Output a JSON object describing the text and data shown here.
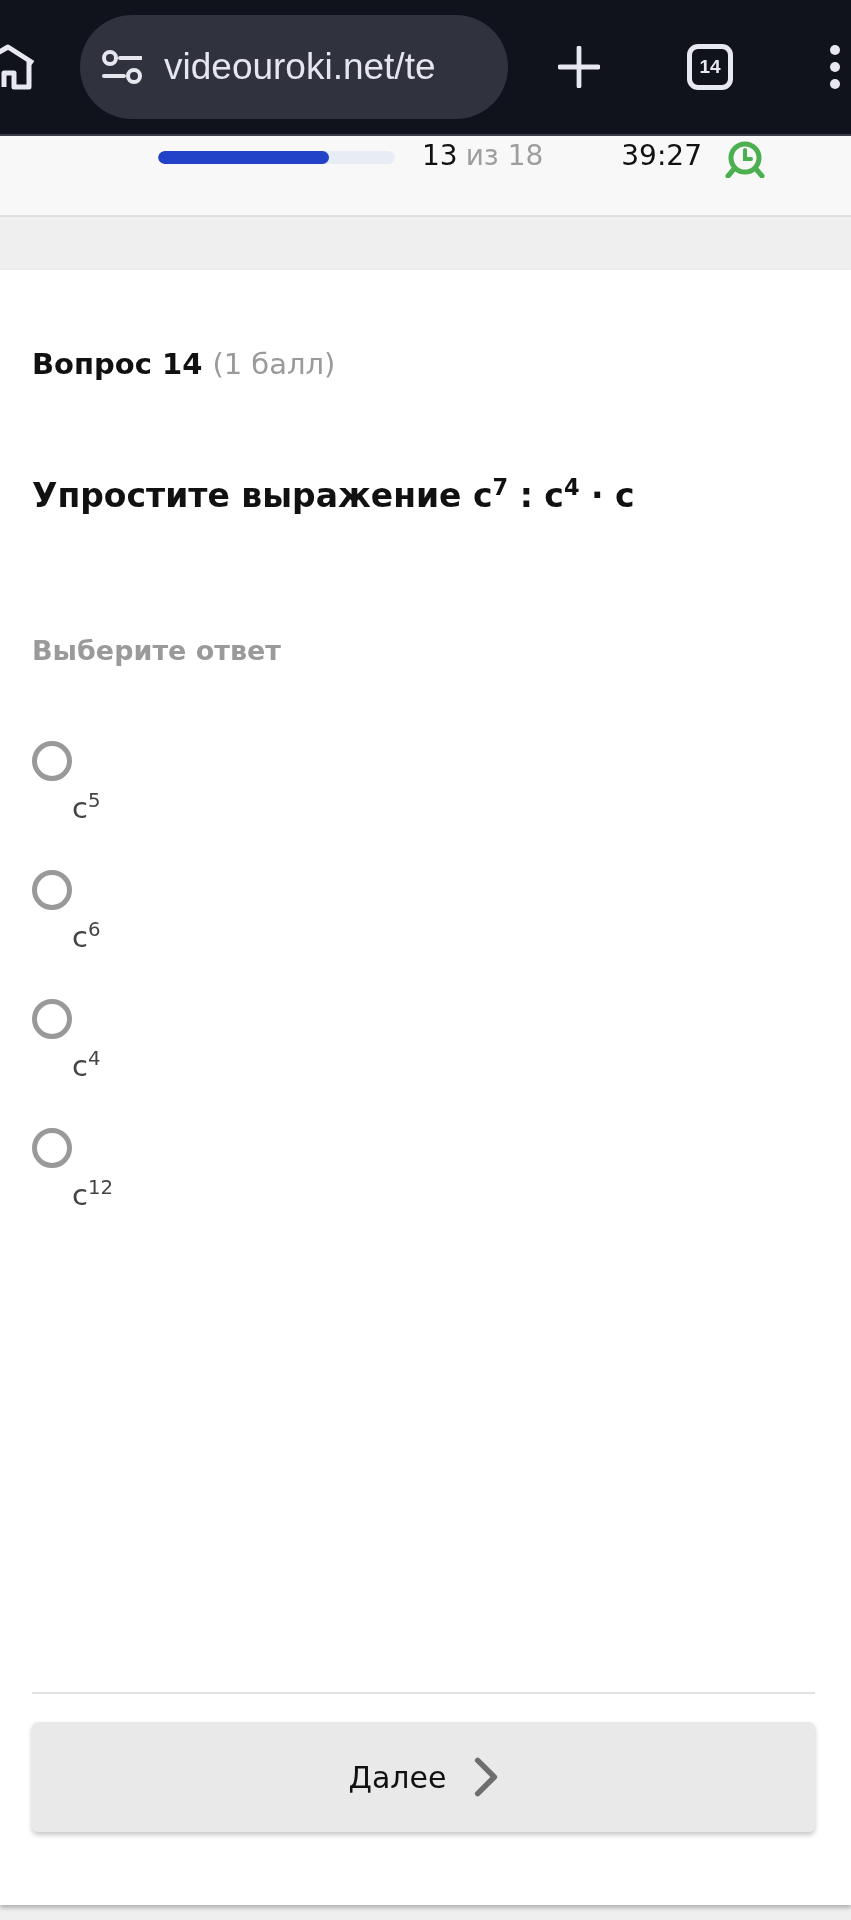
{
  "browser": {
    "url": "videouroki.net/te",
    "tab_count": "14"
  },
  "test_header": {
    "progress": {
      "level": 0.72
    },
    "question_counter": {
      "current": "13",
      "total": "из 18"
    },
    "timer": "39:27"
  },
  "question": {
    "title": "Вопрос 14",
    "points": "(1 балл)",
    "text": "Упростите выражение c$^{7}$ : c$^{4}$ · c",
    "prompt": "Выберите ответ",
    "options": [
      {
        "label": "c$^{5}$",
        "selected": false
      },
      {
        "label": "c$^{6}$",
        "selected": false
      },
      {
        "label": "c$^{4}$",
        "selected": false
      },
      {
        "label": "c$^{12}$",
        "selected": false
      }
    ]
  },
  "next_button": {
    "label": "Далее"
  }
}
